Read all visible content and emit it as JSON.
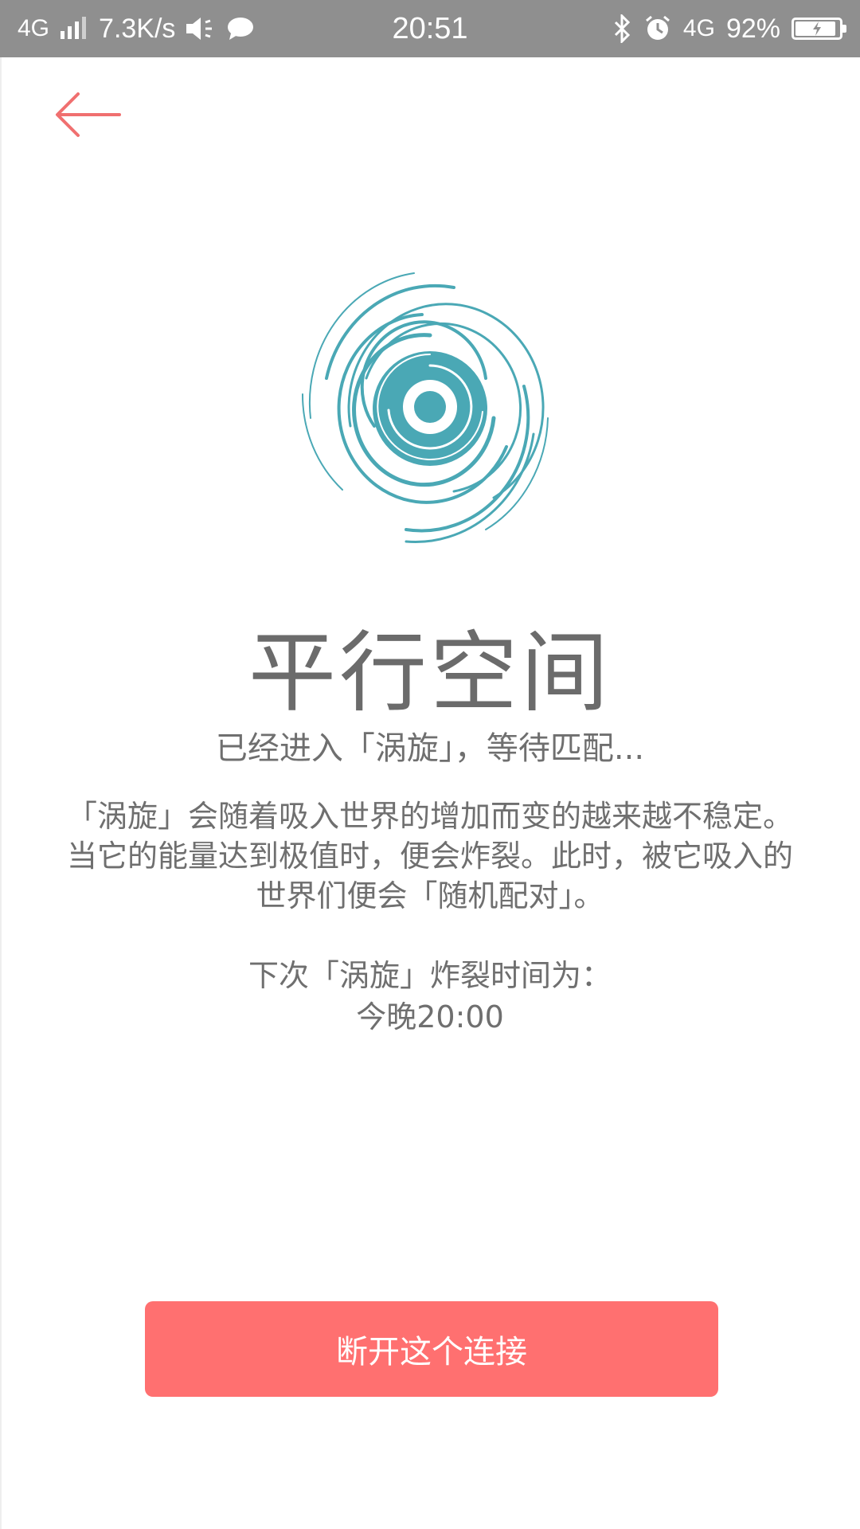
{
  "status_bar": {
    "network": "4G",
    "speed": "7.3K/s",
    "time": "20:51",
    "network_right": "4G",
    "battery_percent": "92%",
    "battery_level": 0.92
  },
  "header": {
    "back_icon": "arrow-left-icon",
    "accent_color": "#f07070"
  },
  "main": {
    "logo_icon": "vortex-icon",
    "vortex_color": "#4aa8b5",
    "title": "平行空间",
    "subtitle": "已经进入「涡旋」，等待匹配...",
    "description": "「涡旋」会随着吸入世界的增加而变的越来越不稳定。当它的能量达到极值时，便会炸裂。此时，被它吸入的世界们便会「随机配对」。",
    "next_label": "下次「涡旋」炸裂时间为：",
    "next_time": "今晚20:00"
  },
  "footer": {
    "disconnect_label": "断开这个连接",
    "button_color": "#ff7070"
  }
}
